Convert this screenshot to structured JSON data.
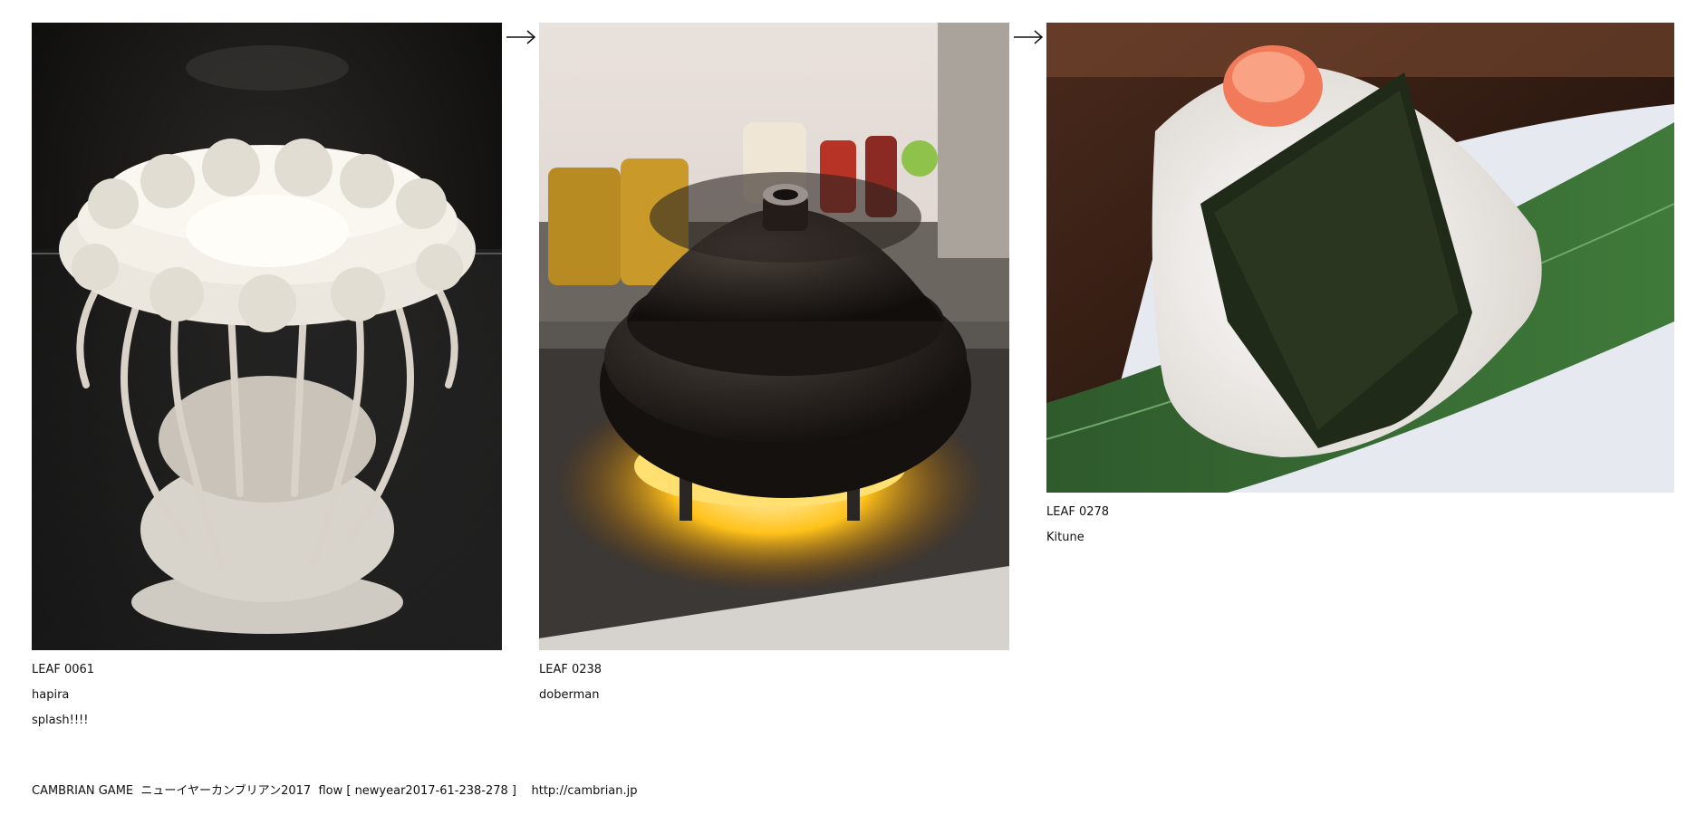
{
  "leaves": [
    {
      "id_label": "LEAF 0061",
      "author": "hapira",
      "comment": "splash!!!!",
      "image_desc": "white ceramic flower-like sculpture with spindly legs in a dark display case"
    },
    {
      "id_label": "LEAF 0238",
      "author": "doberman",
      "comment": "",
      "image_desc": "black clay pot (donabe) on a gas stove burner with glowing flame"
    },
    {
      "id_label": "LEAF 0278",
      "author": "Kitune",
      "comment": "",
      "image_desc": "rice ball (onigiri) wrapped in nori topped with mentaiko on a leaf plate"
    }
  ],
  "arrows": [
    "right-arrow-icon",
    "right-arrow-icon"
  ],
  "footer": {
    "site": "CAMBRIAN GAME",
    "title": "ニューイヤーカンブリアン2017",
    "flow": "flow [ newyear2017-61-238-278 ]",
    "url": "http://cambrian.jp"
  },
  "colors": {
    "background": "#ffffff",
    "text": "#111111"
  }
}
